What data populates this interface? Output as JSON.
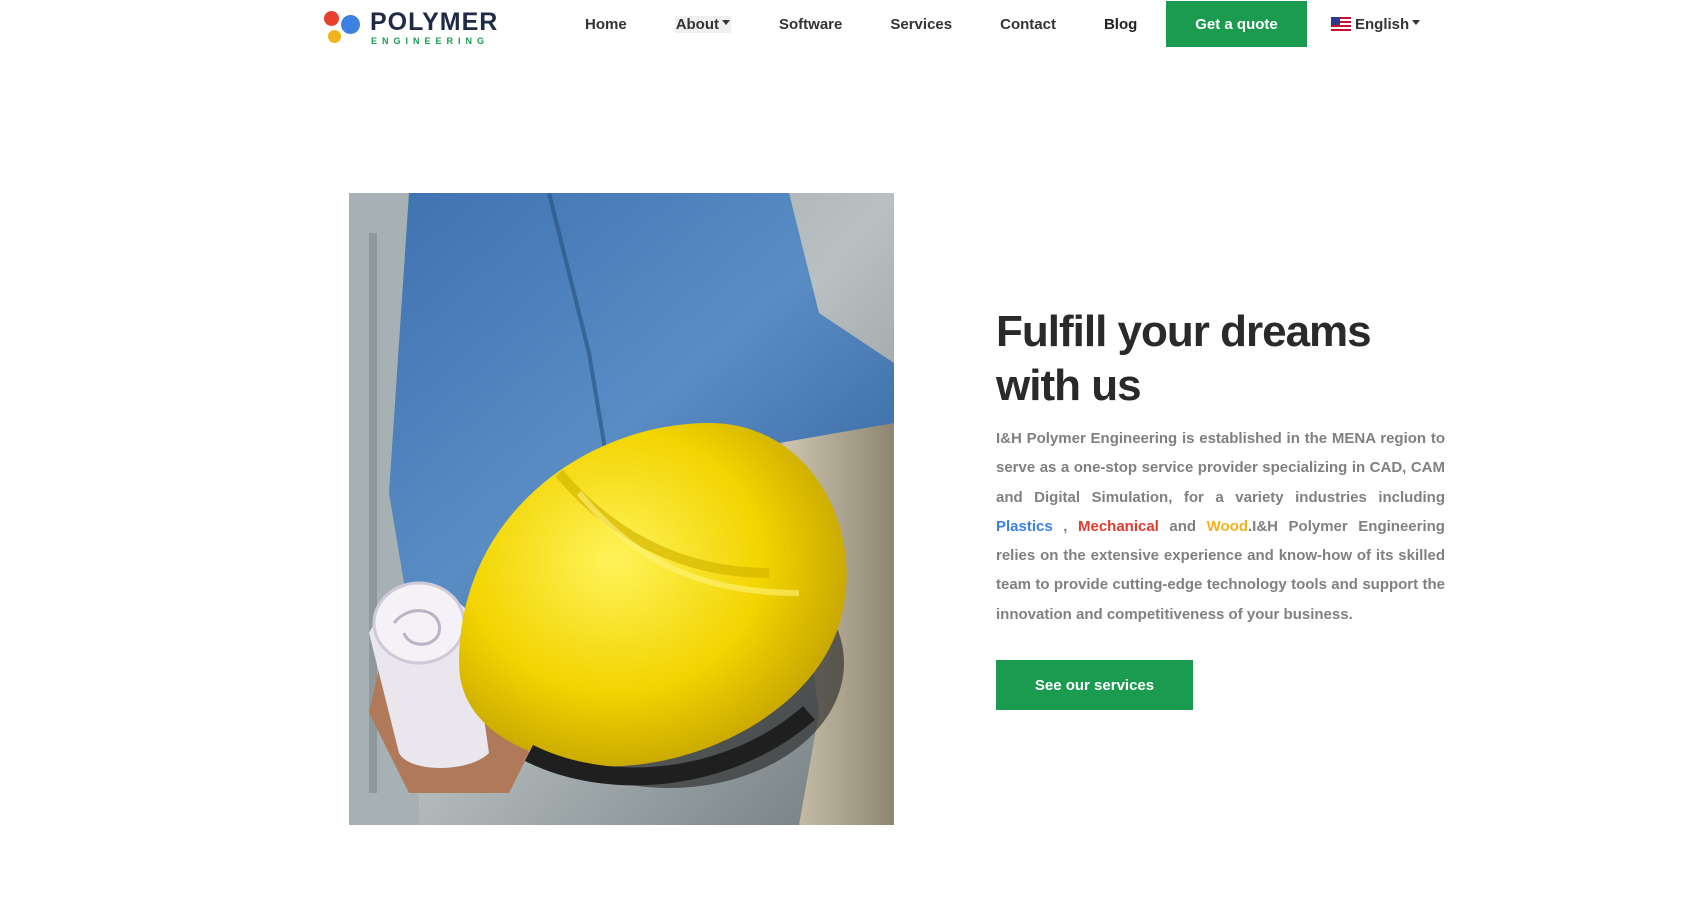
{
  "brand": {
    "name": "POLYMER",
    "tagline": "ENGINEERING",
    "colors": {
      "red": "#e8402f",
      "blue": "#3b82e0",
      "yellow": "#f2b31a",
      "green": "#1a9b50",
      "navy": "#1f2a44"
    }
  },
  "nav": {
    "items": [
      {
        "label": "Home"
      },
      {
        "label": "About",
        "has_dropdown": true
      },
      {
        "label": "Software"
      },
      {
        "label": "Services"
      },
      {
        "label": "Contact"
      },
      {
        "label": "Blog"
      }
    ],
    "cta_label": "Get a quote",
    "language": {
      "label": "English",
      "flag_icon": "us-flag-icon"
    }
  },
  "hero": {
    "image_icon": "worker-hard-hat-photo",
    "headline": "Fulfill your dreams with us",
    "description": {
      "part1": "I&H Polymer Engineering is established in the MENA region to serve as a one-stop service provider specializing in CAD, CAM and Digital Simulation, for a variety industries including ",
      "plastics": "Plastics",
      "sep1": " , ",
      "mechanical": "Mechanical",
      "sep2": " and ",
      "wood": "Wood",
      "part2": ".I&H Polymer Engineering relies on the extensive experience and know-how of its skilled team to provide cutting-edge technology tools and support the innovation and competitiveness of your business."
    },
    "button_label": "See our services"
  }
}
